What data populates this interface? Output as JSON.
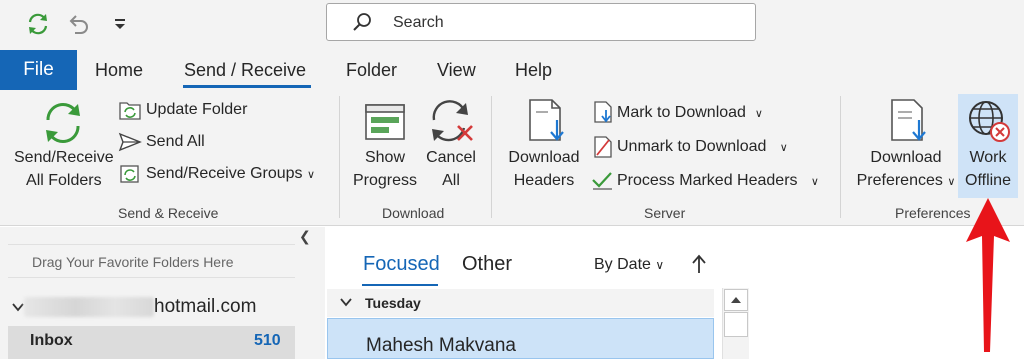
{
  "quick_access": {
    "sync_icon": "sync-icon",
    "undo_icon": "undo-icon",
    "customize_icon": "customize-dropdown-icon"
  },
  "search": {
    "placeholder": "Search"
  },
  "tabs": {
    "file": "File",
    "home": "Home",
    "send_receive": "Send / Receive",
    "folder": "Folder",
    "view": "View",
    "help": "Help"
  },
  "ribbon": {
    "send_receive_group": {
      "send_receive_all_line1": "Send/Receive",
      "send_receive_all_line2": "All Folders",
      "update_folder": "Update Folder",
      "send_all": "Send All",
      "send_receive_groups": "Send/Receive Groups",
      "label": "Send & Receive"
    },
    "download_group": {
      "show_progress_line1": "Show",
      "show_progress_line2": "Progress",
      "cancel_all_line1": "Cancel",
      "cancel_all_line2": "All",
      "label": "Download"
    },
    "server_group": {
      "download_headers_line1": "Download",
      "download_headers_line2": "Headers",
      "mark_to_download": "Mark to Download",
      "unmark_to_download": "Unmark to Download",
      "process_marked_headers": "Process Marked Headers",
      "label": "Server"
    },
    "preferences_group": {
      "download_preferences_line1": "Download",
      "download_preferences_line2": "Preferences",
      "work_offline_line1": "Work",
      "work_offline_line2": "Offline",
      "label": "Preferences"
    }
  },
  "folder_pane": {
    "drag_hint": "Drag Your Favorite Folders Here",
    "account_suffix": "hotmail.com",
    "inbox_label": "Inbox",
    "inbox_count": "510"
  },
  "message_list": {
    "focused_tab": "Focused",
    "other_tab": "Other",
    "sort_label": "By Date",
    "group_header": "Tuesday",
    "first_message_sender": "Mahesh Makvana"
  },
  "colors": {
    "accent": "#1566b6",
    "arrow_annotation": "#e8141a",
    "selection": "#cde3f8"
  }
}
